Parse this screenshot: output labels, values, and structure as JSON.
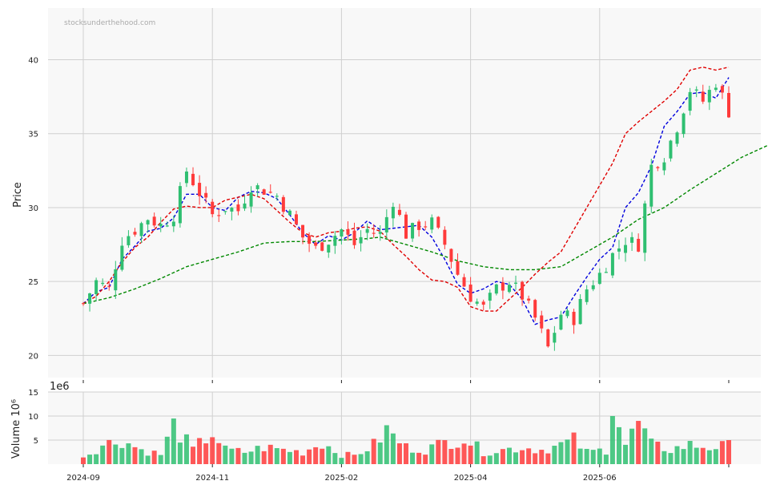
{
  "watermark": "stocksunderthehood.com",
  "colors": {
    "up": "#2fbf71",
    "down": "#ff3b3b",
    "ma_short": "#0000dd",
    "ma_mid": "#e00000",
    "ma_long": "#008800",
    "panel_bg": "#f8f8f8",
    "grid": "#d0d0d0"
  },
  "chart_data": [
    {
      "type": "candlestick",
      "ylabel": "Price",
      "ylim": [
        18.5,
        43.5
      ],
      "yticks": [
        20,
        25,
        30,
        35,
        40
      ],
      "xticks": [
        "2024-09",
        "2024-11",
        "2025-02",
        "2025-04",
        "2025-06"
      ],
      "xtick_positions": [
        0,
        20,
        40,
        60,
        80
      ],
      "n_candles": 101,
      "grid": true,
      "close_anchors": [
        [
          0,
          23.5
        ],
        [
          2,
          25.0
        ],
        [
          4,
          24.5
        ],
        [
          6,
          27.8
        ],
        [
          8,
          28.5
        ],
        [
          10,
          29.3
        ],
        [
          12,
          28.8
        ],
        [
          14,
          29.5
        ],
        [
          16,
          32.5
        ],
        [
          18,
          31.0
        ],
        [
          20,
          29.5
        ],
        [
          22,
          30.0
        ],
        [
          24,
          29.8
        ],
        [
          26,
          31.5
        ],
        [
          28,
          31.2
        ],
        [
          30,
          30.8
        ],
        [
          32,
          29.5
        ],
        [
          34,
          28.0
        ],
        [
          36,
          27.2
        ],
        [
          38,
          27.8
        ],
        [
          40,
          28.5
        ],
        [
          42,
          27.5
        ],
        [
          44,
          28.5
        ],
        [
          46,
          28.2
        ],
        [
          48,
          30.5
        ],
        [
          50,
          28.2
        ],
        [
          52,
          28.8
        ],
        [
          54,
          29.0
        ],
        [
          56,
          27.5
        ],
        [
          58,
          25.5
        ],
        [
          60,
          24.0
        ],
        [
          62,
          23.2
        ],
        [
          64,
          24.5
        ],
        [
          66,
          25.0
        ],
        [
          68,
          24.0
        ],
        [
          70,
          22.5
        ],
        [
          72,
          20.5
        ],
        [
          74,
          22.8
        ],
        [
          76,
          22.5
        ],
        [
          78,
          24.5
        ],
        [
          80,
          25.5
        ],
        [
          82,
          26.8
        ],
        [
          84,
          27.8
        ],
        [
          86,
          27.5
        ],
        [
          88,
          32.8
        ],
        [
          90,
          33.5
        ],
        [
          92,
          35.5
        ],
        [
          94,
          38.0
        ],
        [
          96,
          37.2
        ],
        [
          98,
          38.5
        ],
        [
          100,
          36.5
        ]
      ],
      "ma_lines": [
        {
          "name": "MA short",
          "color_key": "ma_short",
          "values": [
            [
              0,
              23.5
            ],
            [
              2,
              24.3
            ],
            [
              4,
              24.6
            ],
            [
              6,
              26.5
            ],
            [
              8,
              27.4
            ],
            [
              10,
              28.4
            ],
            [
              12,
              28.6
            ],
            [
              14,
              29.3
            ],
            [
              16,
              30.9
            ],
            [
              18,
              30.9
            ],
            [
              20,
              30.0
            ],
            [
              22,
              29.8
            ],
            [
              24,
              30.7
            ],
            [
              26,
              31.1
            ],
            [
              28,
              31.0
            ],
            [
              30,
              30.6
            ],
            [
              32,
              29.5
            ],
            [
              34,
              28.3
            ],
            [
              36,
              27.5
            ],
            [
              38,
              28.1
            ],
            [
              40,
              27.8
            ],
            [
              42,
              28.3
            ],
            [
              44,
              29.1
            ],
            [
              46,
              28.5
            ],
            [
              48,
              28.6
            ],
            [
              50,
              28.7
            ],
            [
              52,
              28.8
            ],
            [
              54,
              28.0
            ],
            [
              56,
              26.5
            ],
            [
              58,
              24.8
            ],
            [
              60,
              24.2
            ],
            [
              62,
              24.5
            ],
            [
              64,
              25.0
            ],
            [
              66,
              24.8
            ],
            [
              68,
              23.8
            ],
            [
              70,
              22.1
            ],
            [
              72,
              22.4
            ],
            [
              74,
              22.6
            ],
            [
              76,
              24.0
            ],
            [
              78,
              25.3
            ],
            [
              80,
              26.5
            ],
            [
              82,
              27.3
            ],
            [
              84,
              30.0
            ],
            [
              86,
              31.0
            ],
            [
              88,
              32.8
            ],
            [
              90,
              35.5
            ],
            [
              92,
              36.5
            ],
            [
              94,
              37.7
            ],
            [
              96,
              37.8
            ],
            [
              98,
              37.4
            ],
            [
              100,
              38.8
            ]
          ]
        },
        {
          "name": "MA mid",
          "color_key": "ma_mid",
          "values": [
            [
              0,
              23.5
            ],
            [
              2,
              24.0
            ],
            [
              4,
              25.0
            ],
            [
              6,
              26.3
            ],
            [
              8,
              27.3
            ],
            [
              10,
              28.0
            ],
            [
              12,
              29.0
            ],
            [
              14,
              29.9
            ],
            [
              16,
              30.1
            ],
            [
              18,
              30.0
            ],
            [
              20,
              30.0
            ],
            [
              22,
              30.5
            ],
            [
              24,
              30.7
            ],
            [
              26,
              30.9
            ],
            [
              28,
              30.6
            ],
            [
              30,
              29.8
            ],
            [
              32,
              29.0
            ],
            [
              34,
              28.3
            ],
            [
              36,
              28.0
            ],
            [
              38,
              28.3
            ],
            [
              40,
              28.4
            ],
            [
              42,
              28.6
            ],
            [
              44,
              28.7
            ],
            [
              46,
              28.4
            ],
            [
              48,
              27.5
            ],
            [
              50,
              26.7
            ],
            [
              52,
              25.8
            ],
            [
              54,
              25.1
            ],
            [
              56,
              25.0
            ],
            [
              58,
              24.6
            ],
            [
              60,
              23.3
            ],
            [
              62,
              23.0
            ],
            [
              64,
              23.0
            ],
            [
              66,
              23.8
            ],
            [
              68,
              24.6
            ],
            [
              70,
              25.5
            ],
            [
              72,
              26.3
            ],
            [
              74,
              27.0
            ],
            [
              76,
              28.5
            ],
            [
              78,
              30.0
            ],
            [
              80,
              31.5
            ],
            [
              82,
              33.0
            ],
            [
              84,
              35.0
            ],
            [
              86,
              35.8
            ],
            [
              88,
              36.5
            ],
            [
              90,
              37.2
            ],
            [
              92,
              38.0
            ],
            [
              94,
              39.3
            ],
            [
              96,
              39.5
            ],
            [
              98,
              39.3
            ],
            [
              100,
              39.5
            ]
          ]
        },
        {
          "name": "MA long",
          "color_key": "ma_long",
          "values": [
            [
              0,
              23.5
            ],
            [
              4,
              23.9
            ],
            [
              8,
              24.5
            ],
            [
              12,
              25.2
            ],
            [
              16,
              26.0
            ],
            [
              20,
              26.5
            ],
            [
              24,
              27.0
            ],
            [
              28,
              27.6
            ],
            [
              32,
              27.7
            ],
            [
              36,
              27.7
            ],
            [
              40,
              27.8
            ],
            [
              44,
              27.9
            ],
            [
              46,
              28.0
            ],
            [
              50,
              27.5
            ],
            [
              54,
              27.0
            ],
            [
              58,
              26.4
            ],
            [
              62,
              26.0
            ],
            [
              66,
              25.8
            ],
            [
              70,
              25.8
            ],
            [
              74,
              26.0
            ],
            [
              78,
              27.0
            ],
            [
              82,
              28.0
            ],
            [
              86,
              29.2
            ],
            [
              90,
              30.0
            ],
            [
              94,
              31.2
            ],
            [
              98,
              32.3
            ],
            [
              102,
              33.4
            ],
            [
              106,
              34.2
            ],
            [
              110,
              35.0
            ]
          ]
        }
      ]
    },
    {
      "type": "bar",
      "ylabel": "Volume  10⁶",
      "offset_label": "1e6",
      "ylim": [
        0,
        15
      ],
      "yticks": [
        5,
        10,
        15
      ],
      "volume_anchors": [
        [
          0,
          1.5
        ],
        [
          3,
          4.0
        ],
        [
          6,
          5.0
        ],
        [
          9,
          3.0
        ],
        [
          12,
          2.0
        ],
        [
          14,
          8.0
        ],
        [
          17,
          3.0
        ],
        [
          20,
          6.5
        ],
        [
          22,
          3.0
        ],
        [
          25,
          2.5
        ],
        [
          28,
          3.5
        ],
        [
          31,
          3.0
        ],
        [
          34,
          2.5
        ],
        [
          37,
          4.5
        ],
        [
          40,
          2.0
        ],
        [
          42,
          1.8
        ],
        [
          45,
          4.0
        ],
        [
          47,
          7.0
        ],
        [
          50,
          3.5
        ],
        [
          53,
          3.0
        ],
        [
          56,
          4.5
        ],
        [
          59,
          5.5
        ],
        [
          62,
          2.5
        ],
        [
          65,
          3.0
        ],
        [
          68,
          3.5
        ],
        [
          71,
          3.0
        ],
        [
          74,
          4.0
        ],
        [
          76,
          5.0
        ],
        [
          78,
          2.5
        ],
        [
          81,
          3.0
        ],
        [
          82,
          13.5
        ],
        [
          84,
          4.0
        ],
        [
          86,
          8.5
        ],
        [
          88,
          4.0
        ],
        [
          91,
          3.0
        ],
        [
          94,
          4.0
        ],
        [
          97,
          3.5
        ],
        [
          100,
          3.8
        ]
      ]
    }
  ]
}
